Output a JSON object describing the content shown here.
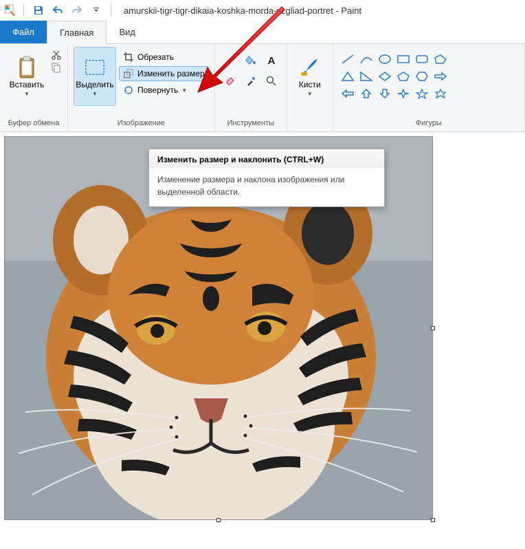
{
  "window": {
    "title": "amurskii-tigr-tigr-dikaia-koshka-morda-vzgliad-portret - Paint"
  },
  "tabs": {
    "file": "Файл",
    "home": "Главная",
    "view": "Вид"
  },
  "ribbon": {
    "clipboard": {
      "paste": "Вставить",
      "label": "Буфер обмена"
    },
    "image": {
      "select": "Выделить",
      "crop": "Обрезать",
      "resize": "Изменить размер",
      "rotate": "Повернуть",
      "label": "Изображение"
    },
    "tools": {
      "label": "Инструменты"
    },
    "brushes": {
      "brushes": "Кисти"
    },
    "shapes": {
      "label": "Фигуры"
    }
  },
  "tooltip": {
    "title": "Изменить размер и наклонить (CTRL+W)",
    "body": "Изменение размера и наклона изображения или выделенной области."
  }
}
